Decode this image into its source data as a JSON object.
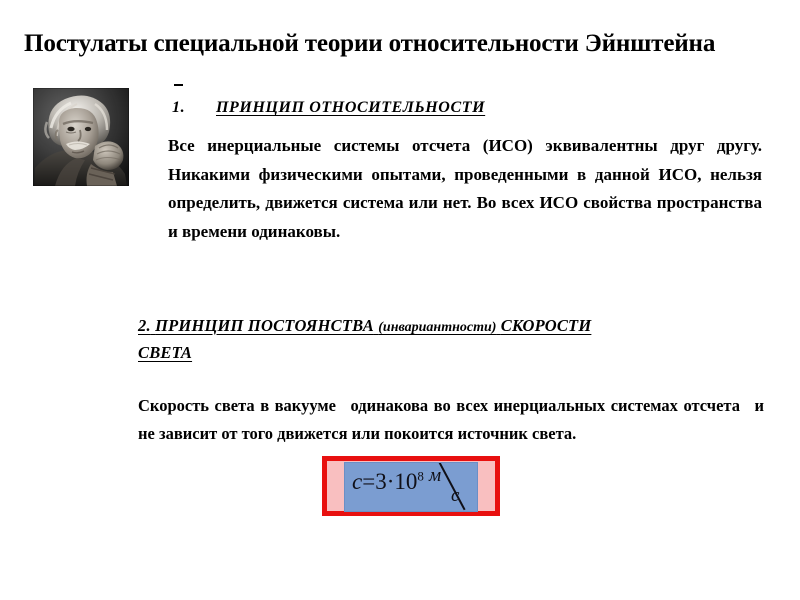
{
  "slide": {
    "title": "Постулаты специальной теории относительности Эйнштейна",
    "background_color": "#ffffff",
    "text_color": "#000000"
  },
  "photo": {
    "caption": "Albert Einstein portrait",
    "style": "black-and-white photograph"
  },
  "postulate_one": {
    "number": "1.",
    "heading": "ПРИНЦИП ОТНОСИТЕЛЬНОСТИ",
    "body": "Все инерциальные системы отсчета (ИСО) эквивалентны друг другу. Никакими физическими опытами, проведенными в данной ИСО, нельзя определить, движется система или нет. Во всех ИСО свойства пространства и времени одинаковы."
  },
  "postulate_two": {
    "number": "2.",
    "heading_main": "ПРИНЦИП ПОСТОЯНСТВА",
    "heading_parenthetical": "(инвариантности)",
    "heading_rest": "СКОРОСТИ",
    "heading_tail": "СВЕТА",
    "body_part_one": "Скорость света в вакууме",
    "body_part_two": "одинакова во всех инерциальных системах отсчета",
    "body_part_three": "и не зависит от того движется или покоится источник света."
  },
  "formula": {
    "variable": "c",
    "equals": "=",
    "coefficient": "3",
    "operator": "·",
    "base": "10",
    "exponent": "8",
    "unit_numerator": "м",
    "unit_denominator": "с",
    "full": "c = 3·10⁸ м/с",
    "border_color": "#e8100f",
    "outer_fill": "#f9bfc0",
    "inner_fill": "#7b9dd1"
  }
}
